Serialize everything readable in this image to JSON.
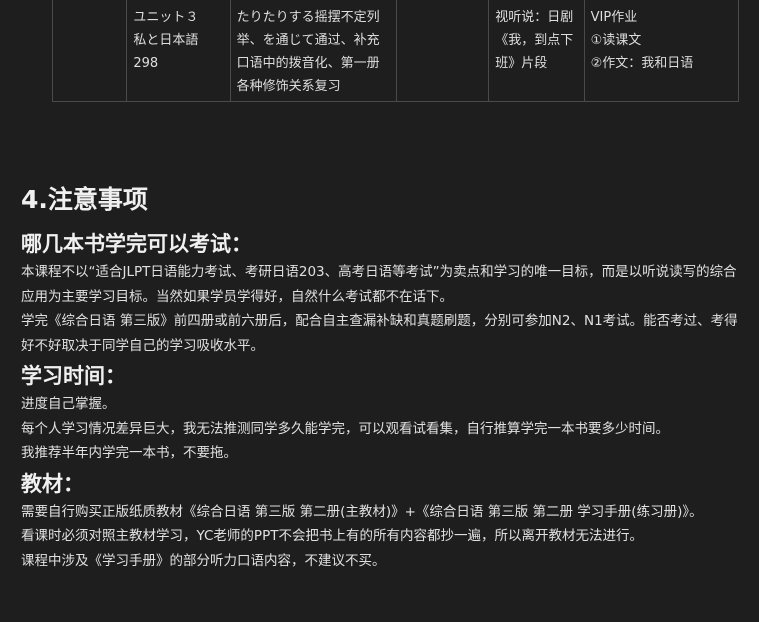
{
  "table": {
    "row": {
      "cell1": "",
      "lesson": "ユニット３　私と日本語 298",
      "topics": "たりたりする摇摆不定列举、を通じて通过、补充口语中的拨音化、第一册各种修饰关系复习",
      "cell4": "",
      "listening": "视听说：日剧《我，到点下班》片段",
      "homework": [
        "VIP作业",
        "①读课文",
        "②作文：我和日语"
      ]
    }
  },
  "notes": {
    "heading": "4.注意事项",
    "exam": {
      "title": "哪几本书学完可以考试：",
      "lines": [
        "本课程不以“适合JLPT日语能力考试、考研日语203、高考日语等考试”为卖点和学习的唯一目标，而是以听说读写的综合应用为主要学习目标。当然如果学员学得好，自然什么考试都不在话下。",
        "学完《综合日语 第三版》前四册或前六册后，配合自主查漏补缺和真题刷题，分别可参加N2、N1考试。能否考过、考得好不好取决于同学自己的学习吸收水平。"
      ]
    },
    "time": {
      "title": "学习时间：",
      "lines": [
        "进度自己掌握。",
        "每个人学习情况差异巨大，我无法推测同学多久能学完，可以观看试看集，自行推算学完一本书要多少时间。",
        "我推荐半年内学完一本书，不要拖。"
      ]
    },
    "materials": {
      "title": "教材：",
      "lines": [
        "需要自行购买正版纸质教材《综合日语 第三版 第二册(主教材)》+《综合日语 第三版 第二册 学习手册(练习册)》。",
        "看课时必须对照主教材学习，YC老师的PPT不会把书上有的所有内容都抄一遍，所以离开教材无法进行。",
        "课程中涉及《学习手册》的部分听力口语内容，不建议不买。"
      ]
    }
  }
}
